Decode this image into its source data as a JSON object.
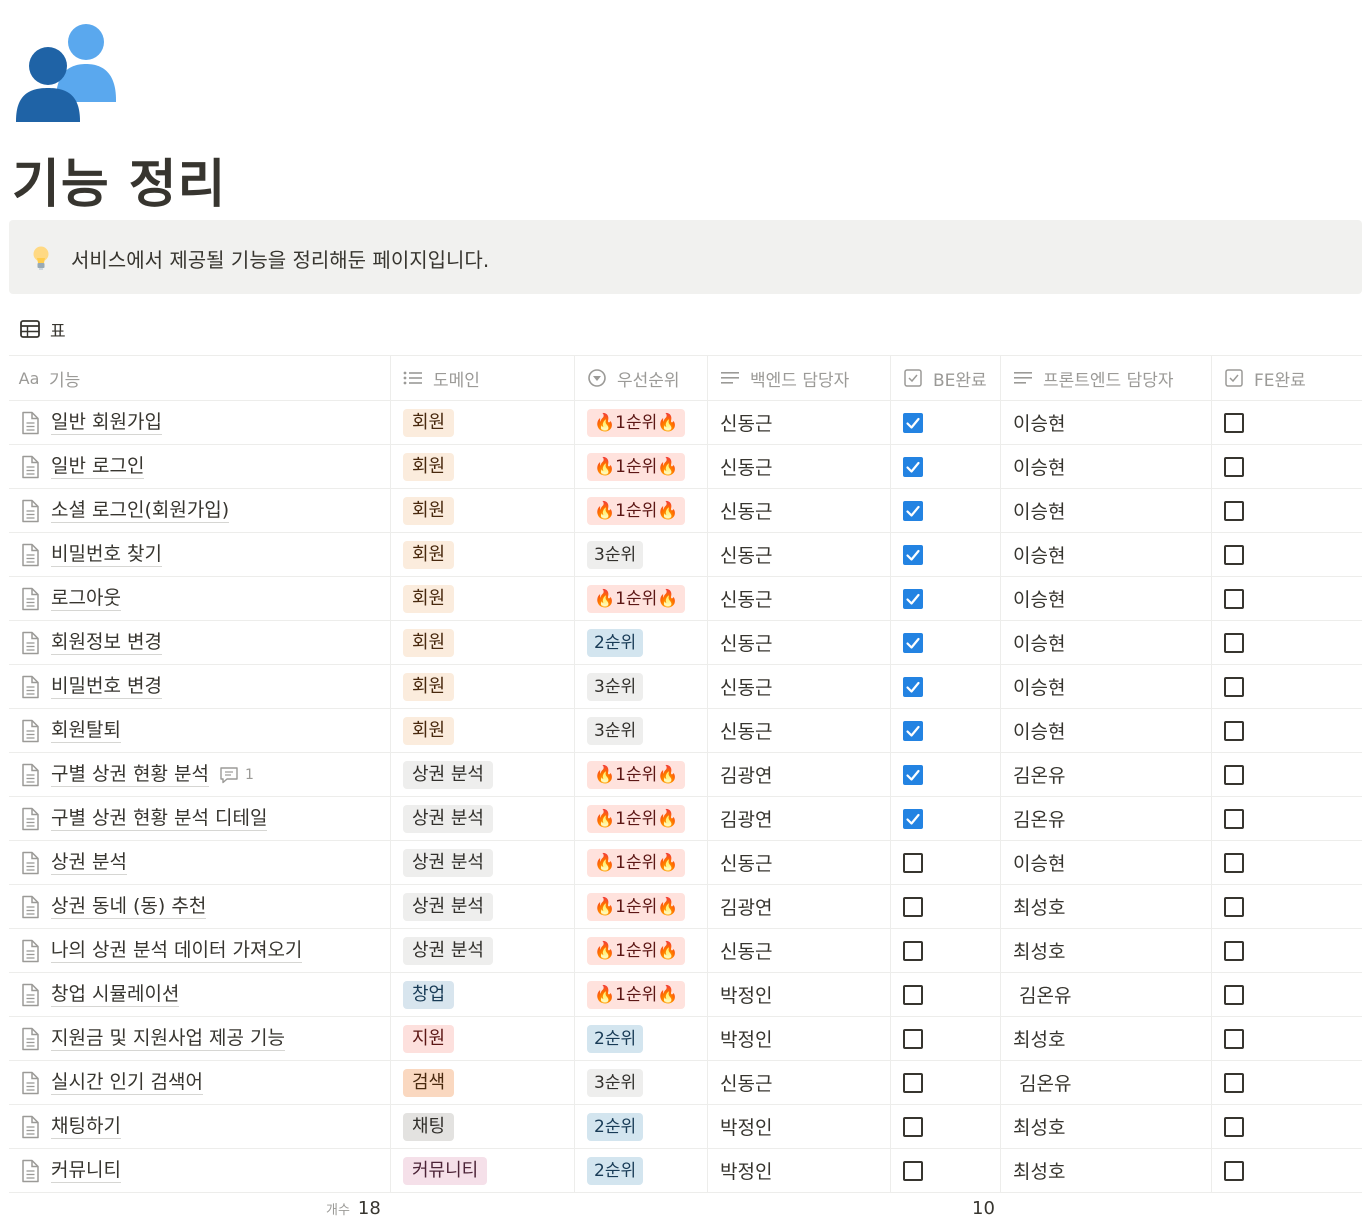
{
  "page": {
    "icon": "people-icon",
    "title": "기능 정리"
  },
  "callout": {
    "icon": "lightbulb-icon",
    "text": "서비스에서 제공될 기능을 정리해둔 페이지입니다."
  },
  "view": {
    "icon": "table-icon",
    "label": "표"
  },
  "columns": {
    "name": "기능",
    "domain": "도메인",
    "priority": "우선순위",
    "backend": "백엔드 담당자",
    "be_done": "BE완료",
    "frontend": "프론트엔드 담당자",
    "fe_done": "FE완료"
  },
  "colors": {
    "회원": {
      "bg": "#fbecdd",
      "fg": "#49290e"
    },
    "상권 분석": {
      "bg": "#eeeeed",
      "fg": "#32302c"
    },
    "창업": {
      "bg": "#d8e5ee",
      "fg": "#183b56"
    },
    "지원": {
      "bg": "#fde0dd",
      "fg": "#5d1715"
    },
    "검색": {
      "bg": "#fad8c0",
      "fg": "#49290e"
    },
    "채팅": {
      "bg": "#e3e2e0",
      "fg": "#32302c"
    },
    "커뮤니티": {
      "bg": "#f5e0e9",
      "fg": "#4c2337"
    },
    "🔥1순위🔥": {
      "bg": "#ffe2dd",
      "fg": "#5d1715"
    },
    "2순위": {
      "bg": "#d3e5ef",
      "fg": "#183b56"
    },
    "3순위": {
      "bg": "#eeeeed",
      "fg": "#32302c"
    }
  },
  "rows": [
    {
      "name": "일반 회원가입",
      "domain": "회원",
      "priority": "🔥1순위🔥",
      "backend": "신동근",
      "be_done": true,
      "frontend": "이승현",
      "fe_done": false
    },
    {
      "name": "일반 로그인",
      "domain": "회원",
      "priority": "🔥1순위🔥",
      "backend": "신동근",
      "be_done": true,
      "frontend": "이승현",
      "fe_done": false
    },
    {
      "name": "소셜 로그인(회원가입)",
      "domain": "회원",
      "priority": "🔥1순위🔥",
      "backend": "신동근",
      "be_done": true,
      "frontend": "이승현",
      "fe_done": false
    },
    {
      "name": "비밀번호 찾기",
      "domain": "회원",
      "priority": "3순위",
      "backend": "신동근",
      "be_done": true,
      "frontend": "이승현",
      "fe_done": false
    },
    {
      "name": "로그아웃",
      "domain": "회원",
      "priority": "🔥1순위🔥",
      "backend": "신동근",
      "be_done": true,
      "frontend": "이승현",
      "fe_done": false
    },
    {
      "name": "회원정보 변경",
      "domain": "회원",
      "priority": "2순위",
      "backend": "신동근",
      "be_done": true,
      "frontend": "이승현",
      "fe_done": false
    },
    {
      "name": "비밀번호 변경",
      "domain": "회원",
      "priority": "3순위",
      "backend": "신동근",
      "be_done": true,
      "frontend": "이승현",
      "fe_done": false
    },
    {
      "name": "회원탈퇴",
      "domain": "회원",
      "priority": "3순위",
      "backend": "신동근",
      "be_done": true,
      "frontend": "이승현",
      "fe_done": false
    },
    {
      "name": "구별 상권 현황 분석",
      "comments": "1",
      "domain": "상권 분석",
      "priority": "🔥1순위🔥",
      "backend": "김광연",
      "be_done": true,
      "frontend": "김온유",
      "fe_done": false
    },
    {
      "name": "구별 상권 현황 분석 디테일",
      "domain": "상권 분석",
      "priority": "🔥1순위🔥",
      "backend": "김광연",
      "be_done": true,
      "frontend": "김온유",
      "fe_done": false
    },
    {
      "name": "상권 분석",
      "domain": "상권 분석",
      "priority": "🔥1순위🔥",
      "backend": "신동근",
      "be_done": false,
      "frontend": "이승현",
      "fe_done": false
    },
    {
      "name": "상권 동네 (동) 추천",
      "domain": "상권 분석",
      "priority": "🔥1순위🔥",
      "backend": "김광연",
      "be_done": false,
      "frontend": "최성호",
      "fe_done": false
    },
    {
      "name": "나의 상권 분석 데이터 가져오기",
      "domain": "상권 분석",
      "priority": "🔥1순위🔥",
      "backend": "신동근",
      "be_done": false,
      "frontend": "최성호",
      "fe_done": false
    },
    {
      "name": "창업 시뮬레이션",
      "domain": "창업",
      "priority": "🔥1순위🔥",
      "backend": "박정인",
      "be_done": false,
      "frontend": " 김온유",
      "fe_done": false
    },
    {
      "name": "지원금 및 지원사업 제공 기능",
      "domain": "지원",
      "priority": "2순위",
      "backend": "박정인",
      "be_done": false,
      "frontend": "최성호",
      "fe_done": false
    },
    {
      "name": "실시간 인기 검색어",
      "domain": "검색",
      "priority": "3순위",
      "backend": "신동근",
      "be_done": false,
      "frontend": " 김온유",
      "fe_done": false
    },
    {
      "name": "채팅하기",
      "domain": "채팅",
      "priority": "2순위",
      "backend": "박정인",
      "be_done": false,
      "frontend": "최성호",
      "fe_done": false
    },
    {
      "name": "커뮤니티",
      "domain": "커뮤니티",
      "priority": "2순위",
      "backend": "박정인",
      "be_done": false,
      "frontend": "최성호",
      "fe_done": false
    }
  ],
  "footer": {
    "count_label": "개수",
    "count_value": "18",
    "be_done_count": "10"
  }
}
